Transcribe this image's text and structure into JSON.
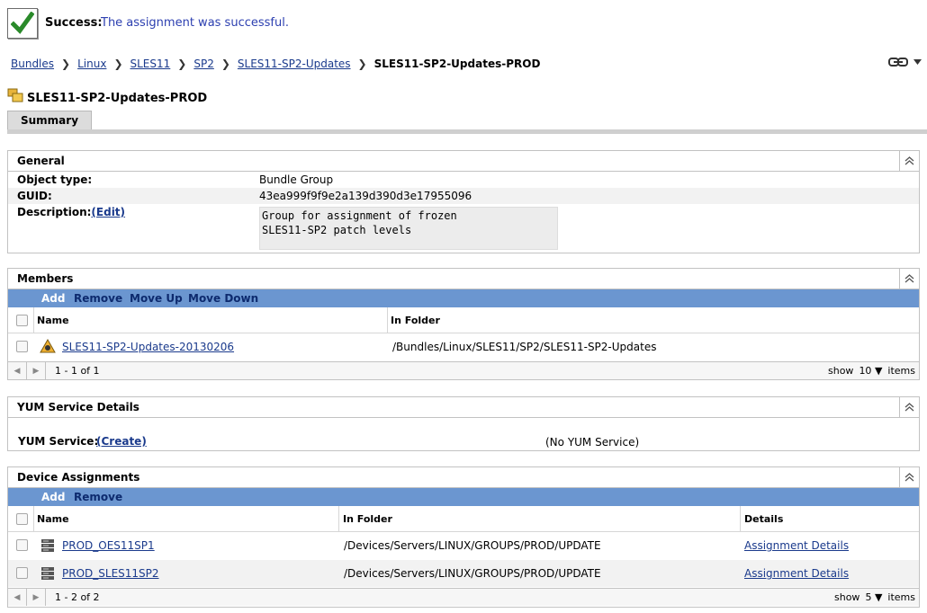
{
  "success": {
    "label": "Success:",
    "message": "The assignment was successful."
  },
  "breadcrumb": {
    "links": [
      "Bundles",
      "Linux",
      "SLES11",
      "SP2",
      "SLES11-SP2-Updates"
    ],
    "current": "SLES11-SP2-Updates-PROD"
  },
  "page": {
    "title": "SLES11-SP2-Updates-PROD"
  },
  "tabs": [
    {
      "label": "Summary"
    }
  ],
  "general": {
    "title": "General",
    "object_type_label": "Object type:",
    "object_type_value": "Bundle Group",
    "guid_label": "GUID:",
    "guid_value": "43ea999f9f9e2a139d390d3e17955096",
    "description_label": "Description:",
    "description_edit": "(Edit)",
    "description_value": "Group for assignment of frozen\nSLES11-SP2 patch levels"
  },
  "members": {
    "title": "Members",
    "toolbar": [
      "Add",
      "Remove",
      "Move Up",
      "Move Down"
    ],
    "columns": [
      "Name",
      "In Folder"
    ],
    "rows": [
      {
        "name": "SLES11-SP2-Updates-20130206",
        "folder": "/Bundles/Linux/SLES11/SP2/SLES11-SP2-Updates"
      }
    ],
    "pager": {
      "range": "1 - 1 of 1",
      "show": "show",
      "count": "10",
      "items": "items"
    }
  },
  "yum": {
    "title": "YUM Service Details",
    "label": "YUM Service:",
    "create": "(Create)",
    "value": "(No YUM Service)"
  },
  "devices": {
    "title": "Device Assignments",
    "toolbar": [
      "Add",
      "Remove"
    ],
    "columns": [
      "Name",
      "In Folder",
      "Details"
    ],
    "rows": [
      {
        "name": "PROD_OES11SP1",
        "folder": "/Devices/Servers/LINUX/GROUPS/PROD/UPDATE",
        "details": "Assignment Details"
      },
      {
        "name": "PROD_SLES11SP2",
        "folder": "/Devices/Servers/LINUX/GROUPS/PROD/UPDATE",
        "details": "Assignment Details"
      }
    ],
    "pager": {
      "range": "1 - 2 of 2",
      "show": "show",
      "count": "5",
      "items": "items"
    }
  },
  "colors": {
    "toolbar": "#6b96d0",
    "link": "#1a3a8c",
    "success_text": "#2c3fb0",
    "check": "#2a8a2a"
  }
}
